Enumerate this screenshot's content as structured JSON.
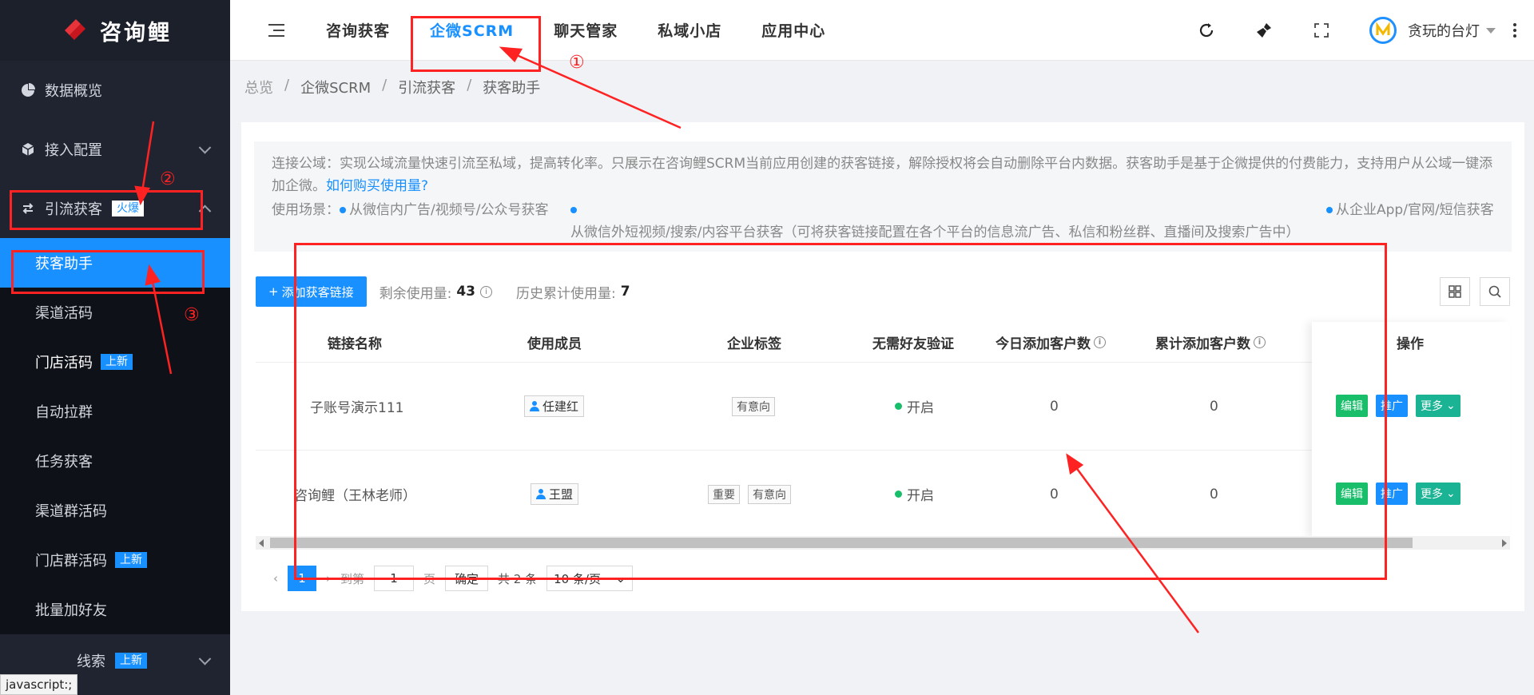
{
  "app": {
    "name": "咨询鲤"
  },
  "sidebar": {
    "items": [
      {
        "label": "数据概览"
      },
      {
        "label": "接入配置"
      },
      {
        "label": "引流获客",
        "badge": "火爆"
      }
    ],
    "submenu": [
      {
        "label": "获客助手"
      },
      {
        "label": "渠道活码"
      },
      {
        "label": "门店活码",
        "badge": "上新"
      },
      {
        "label": "自动拉群"
      },
      {
        "label": "任务获客"
      },
      {
        "label": "渠道群活码"
      },
      {
        "label": "门店群活码",
        "badge": "上新"
      },
      {
        "label": "批量加好友"
      }
    ],
    "bottom_item": {
      "label": "线索",
      "badge": "上新"
    },
    "status_text": "javascript:;"
  },
  "header": {
    "tabs": [
      "咨询获客",
      "企微SCRM",
      "聊天管家",
      "私域小店",
      "应用中心"
    ],
    "active_tab": "企微SCRM",
    "username": "贪玩的台灯"
  },
  "breadcrumb": [
    "总览",
    "企微SCRM",
    "引流获客",
    "获客助手"
  ],
  "notice": {
    "text": "连接公域：实现公域流量快速引流至私域，提高转化率。只展示在咨询鲤SCRM当前应用创建的获客链接，解除授权将会自动删除平台内数据。获客助手是基于企微提供的付费能力，支持用户从公域一键添加企微。",
    "link": "如何购买使用量?",
    "scenario_label": "使用场景：",
    "scenarios": [
      "从微信内广告/视频号/公众号获客",
      "从微信外短视频/搜索/内容平台获客（可将获客链接配置在各个平台的信息流广告、私信和粉丝群、直播间及搜索广告中）",
      "从企业App/官网/短信获客"
    ]
  },
  "toolbar": {
    "add_label": "添加获客链接",
    "remaining_label": "剩余使用量:",
    "remaining_value": "43",
    "history_label": "历史累计使用量:",
    "history_value": "7"
  },
  "table": {
    "columns": [
      "链接名称",
      "使用成员",
      "企业标签",
      "无需好友验证",
      "今日添加客户数",
      "累计添加客户数",
      "操作"
    ],
    "rows": [
      {
        "name": "子账号演示111",
        "member": "任建红",
        "tags": [
          "有意向"
        ],
        "verify": "开启",
        "today": "0",
        "total": "0"
      },
      {
        "name": "咨询鲤（王林老师）",
        "member": "王盟",
        "tags": [
          "重要",
          "有意向"
        ],
        "verify": "开启",
        "today": "0",
        "total": "0"
      }
    ],
    "actions": {
      "edit": "编辑",
      "promote": "推广",
      "more": "更多"
    }
  },
  "pager": {
    "current": "1",
    "goto_label": "到第",
    "goto_value": "1",
    "page_unit": "页",
    "confirm": "确定",
    "total": "共 2 条",
    "page_size": "10 条/页"
  },
  "annotations": {
    "n1": "①",
    "n2": "②",
    "n3": "③"
  },
  "colors": {
    "accent": "#1890ff",
    "sidebar_bg": "#1f2430",
    "annotation": "#ff2222",
    "success": "#19be6b"
  }
}
